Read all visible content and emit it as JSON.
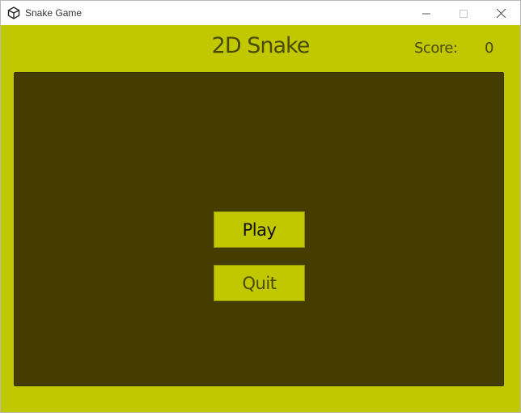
{
  "window": {
    "title": "Snake Game",
    "app_icon": "unity-logo-icon",
    "controls": {
      "minimize": "—",
      "maximize": "☐",
      "close": "✕"
    }
  },
  "header": {
    "game_title": "2D Snake",
    "score_label": "Score:",
    "score_value": "0"
  },
  "menu": {
    "play_label": "Play",
    "quit_label": "Quit"
  },
  "colors": {
    "background": "#c2c800",
    "board": "#453c00",
    "text_dark": "#4a4a00",
    "button_bg": "#c2c800"
  }
}
